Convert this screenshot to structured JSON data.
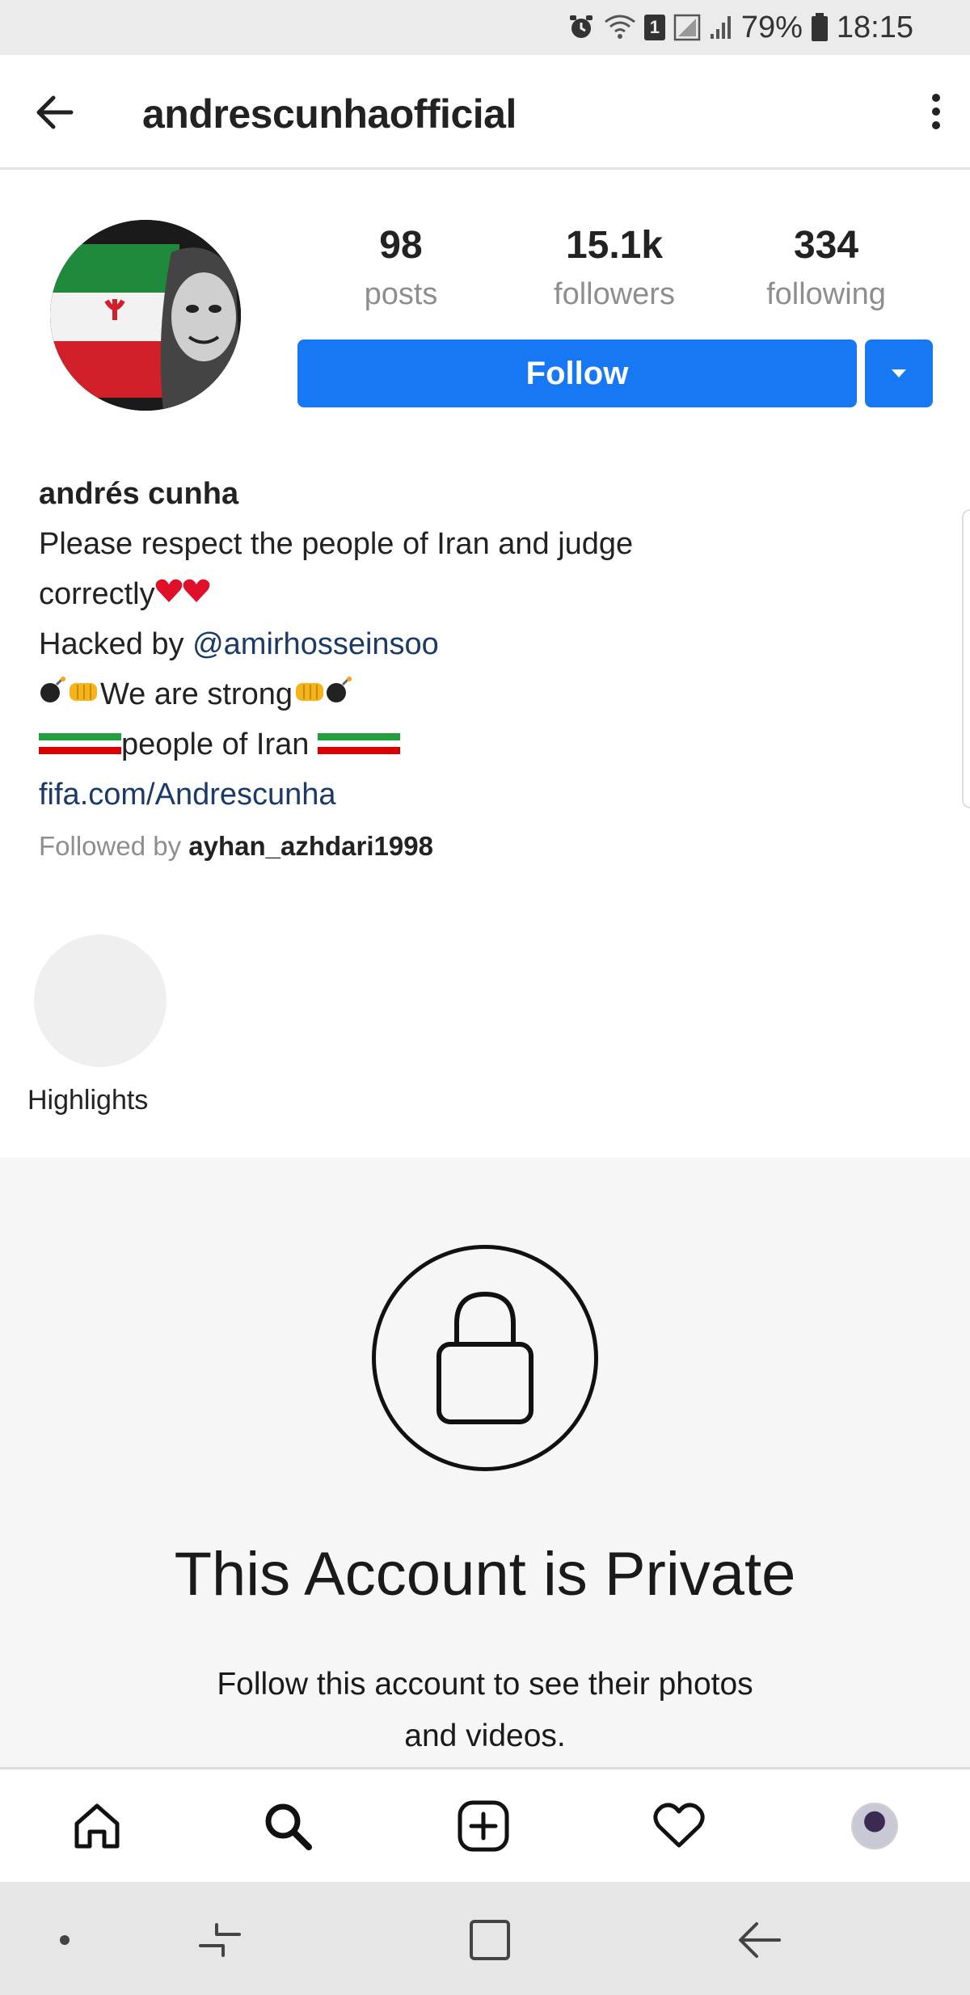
{
  "status_bar": {
    "battery_percent": "79%",
    "time": "18:15",
    "sim_label": "1",
    "icons": [
      "alarm-icon",
      "wifi-icon",
      "sim-icon",
      "signal-icon",
      "battery-icon"
    ]
  },
  "header": {
    "username": "andrescunhaofficial",
    "icons": [
      "back-arrow-icon",
      "more-options-icon"
    ]
  },
  "profile": {
    "stats": [
      {
        "value": "98",
        "label": "posts"
      },
      {
        "value": "15.1k",
        "label": "followers"
      },
      {
        "value": "334",
        "label": "following"
      }
    ],
    "follow_label": "Follow",
    "accent_color": "#1877f2"
  },
  "bio": {
    "name": "andrés cunha",
    "line1": "Please respect the people of Iran and judge",
    "line2": "correctly",
    "line3_prefix": "Hacked by ",
    "mention": "@amirhosseinsoo",
    "line4": "We are strong",
    "line5": "people of Iran ",
    "link": "fifa.com/Andrescunha",
    "followed_by_prefix": "Followed by ",
    "followed_by_user": "ayhan_azhdari1998",
    "link_color": "#1b3a68"
  },
  "highlights": {
    "label": "Highlights"
  },
  "private": {
    "title": "This Account is Private",
    "subtitle_line1": "Follow this account to see their photos",
    "subtitle_line2": "and videos."
  },
  "bottom_nav": {
    "items": [
      "home-icon",
      "search-icon",
      "add-post-icon",
      "activity-heart-icon",
      "profile-avatar"
    ]
  },
  "system_nav": {
    "items": [
      "dot-indicator",
      "recent-apps-icon",
      "home-square-icon",
      "back-icon"
    ]
  }
}
